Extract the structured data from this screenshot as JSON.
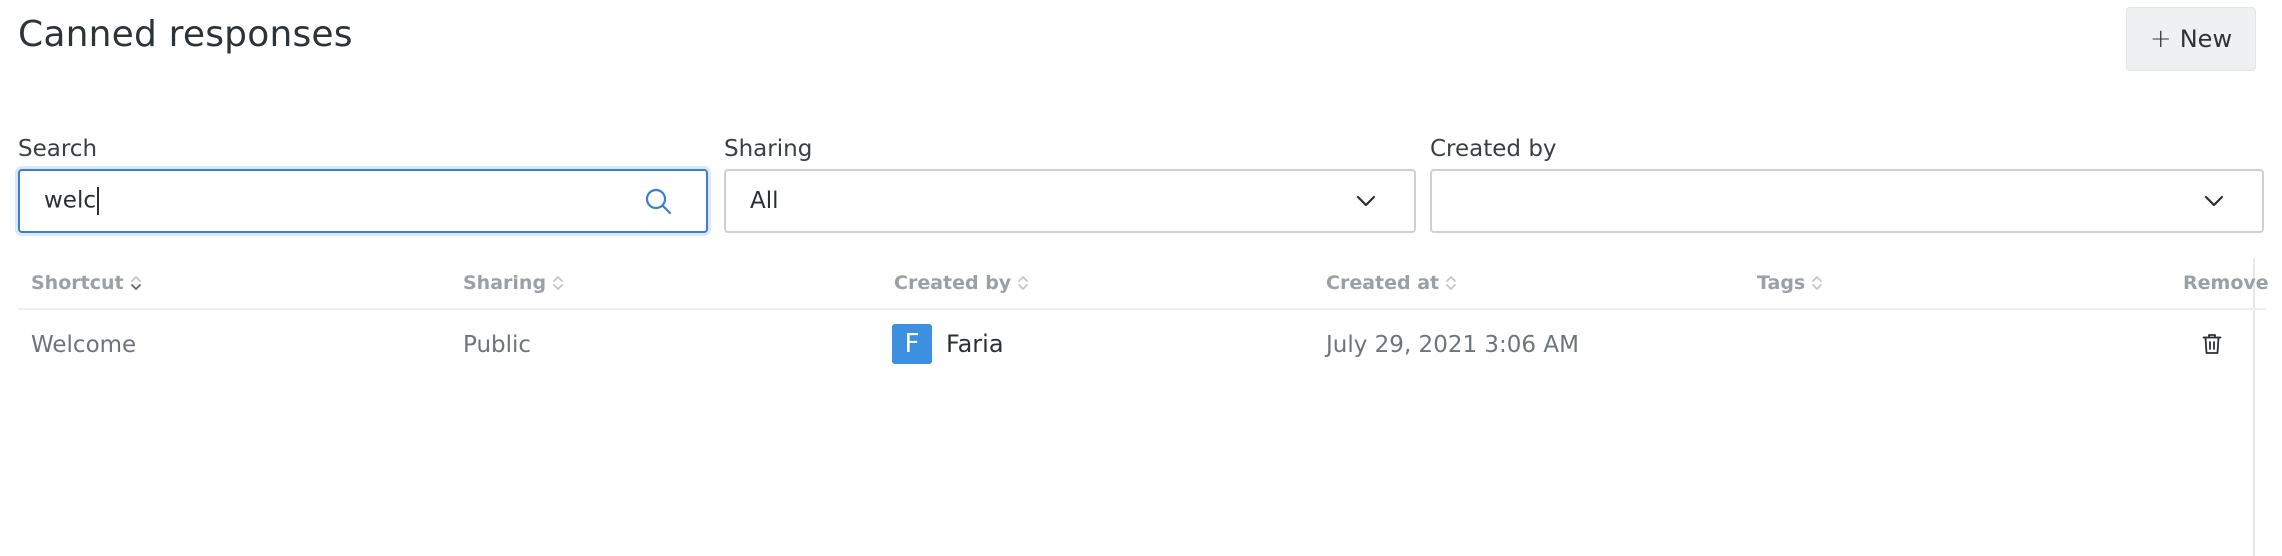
{
  "header": {
    "title": "Canned responses",
    "new_button_label": "New",
    "new_button_icon": "plus-icon"
  },
  "filters": {
    "search": {
      "label": "Search",
      "value": "welc",
      "icon": "search-icon"
    },
    "sharing": {
      "label": "Sharing",
      "value": "All",
      "icon": "chevron-down-icon"
    },
    "created_by": {
      "label": "Created by",
      "value": "",
      "icon": "chevron-down-icon"
    }
  },
  "table": {
    "columns": [
      {
        "label": "Shortcut",
        "sort": "active"
      },
      {
        "label": "Sharing",
        "sort": "none"
      },
      {
        "label": "Created by",
        "sort": "none"
      },
      {
        "label": "Created at",
        "sort": "none"
      },
      {
        "label": "Tags",
        "sort": "none"
      },
      {
        "label": "Remove"
      }
    ],
    "rows": [
      {
        "shortcut": "Welcome",
        "sharing": "Public",
        "creator_initial": "F",
        "creator_name": "Faria",
        "created_at": "July 29, 2021 3:06 AM",
        "tags": "",
        "remove_icon": "trash-icon"
      }
    ]
  },
  "colors": {
    "accent": "#3b7dd0",
    "avatar": "#3d8fe0",
    "header_text": "#9aa0a6"
  }
}
